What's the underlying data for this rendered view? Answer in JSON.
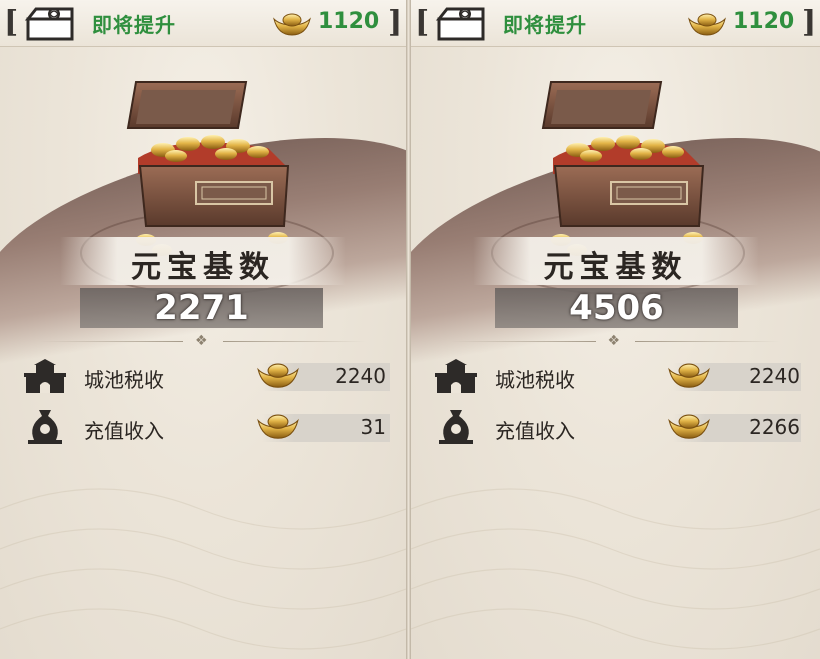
{
  "panels": [
    {
      "status_text": "即将提升",
      "top_amount": "1120",
      "title": "元宝基数",
      "base_value": "2271",
      "rows": [
        {
          "label": "城池税收",
          "value": "2240",
          "icon": "city-wall-icon"
        },
        {
          "label": "充值收入",
          "value": "31",
          "icon": "money-bag-icon"
        }
      ]
    },
    {
      "status_text": "即将提升",
      "top_amount": "1120",
      "title": "元宝基数",
      "base_value": "4506",
      "rows": [
        {
          "label": "城池税收",
          "value": "2240",
          "icon": "city-wall-icon"
        },
        {
          "label": "充值收入",
          "value": "2266",
          "icon": "money-bag-icon"
        }
      ]
    }
  ],
  "colors": {
    "status_green": "#2f8f3e",
    "gold": "#d8a93a",
    "parchment": "#ece5d9"
  }
}
